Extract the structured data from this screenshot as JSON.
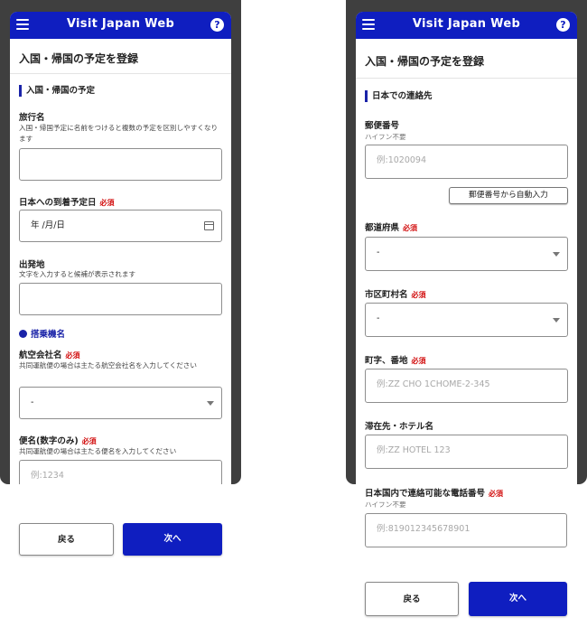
{
  "app": {
    "title": "Visit Japan Web",
    "help_glyph": "?",
    "brand_color": "#0f1ec0",
    "required_color": "#d20f0f"
  },
  "left": {
    "page_title": "入国・帰国の予定を登録",
    "section": "入国・帰国の予定",
    "trip_name": {
      "label": "旅行名",
      "help": "入国・帰国予定に名前をつけると複数の予定を区別しやすくなります",
      "value": ""
    },
    "arrival_date": {
      "label": "日本への到着予定日",
      "required": "必須",
      "value": "年 /月/日"
    },
    "departure": {
      "label": "出発地",
      "help": "文字を入力すると候補が表示されます",
      "value": ""
    },
    "flight_section": "搭乗機名",
    "airline": {
      "label": "航空会社名",
      "required": "必須",
      "help": "共同運航便の場合は主たる航空会社名を入力してください",
      "value": "-"
    },
    "flight_number": {
      "label": "便名(数字のみ)",
      "required": "必須",
      "help": "共同運航便の場合は主たる便名を入力してください",
      "placeholder": "例:1234"
    },
    "back_label": "戻る",
    "next_label": "次へ"
  },
  "right": {
    "page_title": "入国・帰国の予定を登録",
    "section": "日本での連絡先",
    "postal": {
      "label": "郵便番号",
      "help": "ハイフン不要",
      "placeholder": "例:1020094",
      "autofill_label": "郵便番号から自動入力"
    },
    "prefecture": {
      "label": "都道府県",
      "required": "必須",
      "value": "-"
    },
    "city": {
      "label": "市区町村名",
      "required": "必須",
      "value": "-"
    },
    "address": {
      "label": "町字、番地",
      "required": "必須",
      "placeholder": "例:ZZ CHO 1CHOME-2-345"
    },
    "hotel": {
      "label": "滞在先・ホテル名",
      "placeholder": "例:ZZ HOTEL 123"
    },
    "phone": {
      "label": "日本国内で連絡可能な電話番号",
      "required": "必須",
      "help": "ハイフン不要",
      "placeholder": "例:819012345678901"
    },
    "back_label": "戻る",
    "next_label": "次へ"
  }
}
